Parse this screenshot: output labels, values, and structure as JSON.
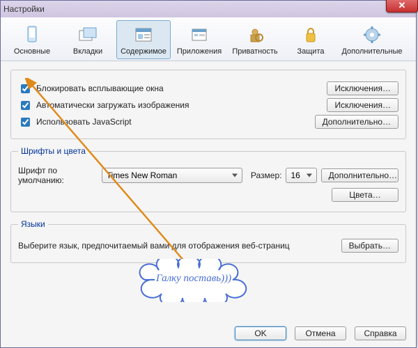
{
  "window": {
    "title": "Настройки"
  },
  "toolbar": {
    "items": [
      {
        "label": "Основные"
      },
      {
        "label": "Вкладки"
      },
      {
        "label": "Содержимое"
      },
      {
        "label": "Приложения"
      },
      {
        "label": "Приватность"
      },
      {
        "label": "Защита"
      },
      {
        "label": "Дополнительные"
      }
    ]
  },
  "general": {
    "block_popups": "Блокировать всплывающие окна",
    "load_images": "Автоматически загружать изображения",
    "use_js": "Использовать JavaScript",
    "exceptions": "Исключения…",
    "advanced": "Дополнительно…"
  },
  "fonts": {
    "legend": "Шрифты и цвета",
    "default_font_label": "Шрифт по умолчанию:",
    "font_name": "Times New Roman",
    "size_label": "Размер:",
    "size_value": "16",
    "advanced": "Дополнительно…",
    "colors": "Цвета…"
  },
  "lang": {
    "legend": "Языки",
    "desc": "Выберите язык, предпочитаемый вами для отображения веб-страниц",
    "choose": "Выбрать…"
  },
  "footer": {
    "ok": "OK",
    "cancel": "Отмена",
    "help": "Справка"
  },
  "annotation": {
    "text": "Галку поставь)))"
  }
}
